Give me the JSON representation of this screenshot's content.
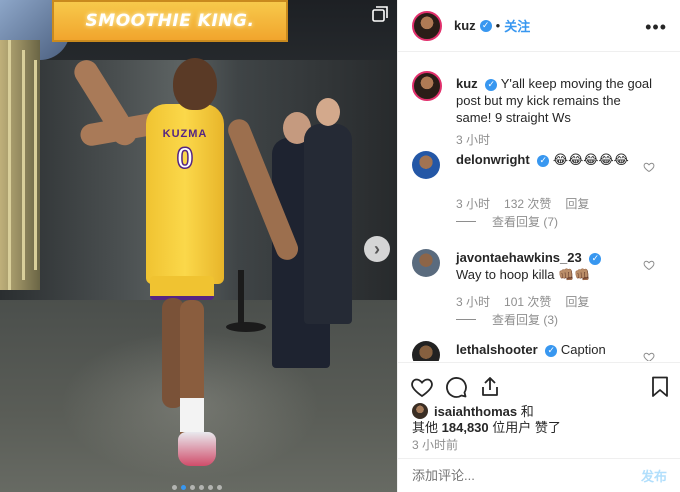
{
  "media": {
    "sponsor_text": "SMOOTHIE KING.",
    "jersey_name": "KUZMA",
    "jersey_number": "0",
    "next_arrow": "›",
    "carousel_count": 6,
    "carousel_active": 1
  },
  "header": {
    "username": "kuz",
    "verified_mark": "✓",
    "follow_label": "关注",
    "more_icon": "•••"
  },
  "caption": {
    "username": "kuz",
    "text": "Y'all keep moving the goal post but my kick remains the same! 9 straight Ws",
    "time": "3 小时"
  },
  "comments": [
    {
      "username": "delonwright",
      "text": "😂😂😂😂😂",
      "time": "3 小时",
      "likes": "132 次赞",
      "reply_label": "回复",
      "view_replies": "查看回复 (7)"
    },
    {
      "username": "javontaehawkins_23",
      "text": "Way to hoop killa 👊🏽👊🏽",
      "time": "3 小时",
      "likes": "101 次赞",
      "reply_label": "回复",
      "view_replies": "查看回复 (3)"
    },
    {
      "username": "lethalshooter",
      "text": "Caption"
    }
  ],
  "likes": {
    "first_liker": "isaiahthomas",
    "and_label": "和",
    "others_prefix": "其他",
    "others_count": "184,830",
    "others_suffix": "位用户 赞了"
  },
  "post_time": "3 小时前",
  "add_comment": {
    "placeholder": "添加评论...",
    "post_label": "发布"
  },
  "colors": {
    "accent": "#3897f0",
    "post_disabled": "#b2dffc",
    "jersey_gold": "#fdb927",
    "jersey_purple": "#552583"
  },
  "icons": [
    "heart-icon",
    "comment-icon",
    "share-icon",
    "bookmark-icon",
    "more-icon",
    "verified-icon",
    "carousel-icon",
    "next-arrow-icon"
  ]
}
